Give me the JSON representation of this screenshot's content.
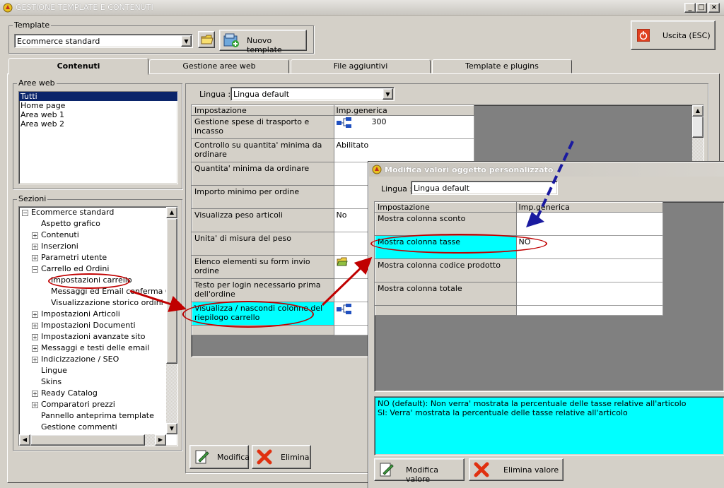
{
  "window": {
    "title": "GESTIONE TEMPLATE E CONTENUTI",
    "min": "_",
    "max": "□",
    "close": "×"
  },
  "template": {
    "group_label": "Template",
    "selected": "Ecommerce standard",
    "new_button": "Nuovo template"
  },
  "exit_button": "Uscita (ESC)",
  "tabs": [
    {
      "label": "Contenuti",
      "active": true
    },
    {
      "label": "Gestione aree web"
    },
    {
      "label": "File aggiuntivi"
    },
    {
      "label": "Template e plugins"
    }
  ],
  "aree_web": {
    "label": "Aree web",
    "items": [
      "Tutti",
      "Home page",
      "Area web 1",
      "Area web 2"
    ],
    "selected_index": 0
  },
  "sezioni": {
    "label": "Sezioni",
    "tree": [
      {
        "label": "Ecommerce standard",
        "level": 0,
        "expander": "−"
      },
      {
        "label": "Aspetto grafico",
        "level": 1,
        "expander": ""
      },
      {
        "label": "Contenuti",
        "level": 1,
        "expander": "+"
      },
      {
        "label": "Inserzioni",
        "level": 1,
        "expander": "+"
      },
      {
        "label": "Parametri utente",
        "level": 1,
        "expander": "+"
      },
      {
        "label": "Carrello ed Ordini",
        "level": 1,
        "expander": "−"
      },
      {
        "label": "Impostazioni carrello",
        "level": 2,
        "expander": ""
      },
      {
        "label": "Messaggi ed Email conferma Ordini",
        "level": 2,
        "expander": ""
      },
      {
        "label": "Visualizzazione storico ordini",
        "level": 2,
        "expander": ""
      },
      {
        "label": "Impostazioni Articoli",
        "level": 1,
        "expander": "+"
      },
      {
        "label": "Impostazioni Documenti",
        "level": 1,
        "expander": "+"
      },
      {
        "label": "Impostazioni avanzate sito",
        "level": 1,
        "expander": "+"
      },
      {
        "label": "Messaggi e testi delle email",
        "level": 1,
        "expander": "+"
      },
      {
        "label": "Indicizzazione / SEO",
        "level": 1,
        "expander": "+"
      },
      {
        "label": "Lingue",
        "level": 1,
        "expander": ""
      },
      {
        "label": "Skins",
        "level": 1,
        "expander": ""
      },
      {
        "label": "Ready Catalog",
        "level": 1,
        "expander": "+"
      },
      {
        "label": "Comparatori prezzi",
        "level": 1,
        "expander": "+"
      },
      {
        "label": "Pannello anteprima template",
        "level": 1,
        "expander": ""
      },
      {
        "label": "Gestione commenti",
        "level": 1,
        "expander": ""
      }
    ]
  },
  "main": {
    "lingua_label": "Lingua :",
    "lingua_value": "Lingua default",
    "col_impostazione": "Impostazione",
    "col_generica": "Imp.generica",
    "rows": [
      {
        "key": "Gestione spese di trasporto e incasso",
        "value": "300",
        "icon": "tree-icon"
      },
      {
        "key": "Controllo su quantita' minima da ordinare",
        "value": "Abilitato"
      },
      {
        "key": "Quantita' minima da ordinare",
        "value": ""
      },
      {
        "key": "Importo minimo per ordine",
        "value": ""
      },
      {
        "key": "Visualizza peso articoli",
        "value": "No"
      },
      {
        "key": "Unita' di misura del peso",
        "value": ""
      },
      {
        "key": "Elenco elementi su form invio ordine",
        "value": "",
        "icon": "folder-icon"
      },
      {
        "key": "Testo per login necessario prima dell'ordine",
        "value": ""
      },
      {
        "key": "Visualizza / nascondi colonne del riepilogo carrello",
        "value": "",
        "icon": "tree-icon",
        "highlight": true
      }
    ],
    "modifica": "Modifica",
    "elimina": "Elimina"
  },
  "dialog": {
    "title": "Modifica valori oggetto personalizzato",
    "lingua_label": "Lingua :",
    "lingua_value": "Lingua default",
    "col_impostazione": "Impostazione",
    "col_generica": "Imp.generica",
    "rows": [
      {
        "key": "Mostra colonna sconto",
        "value": ""
      },
      {
        "key": "Mostra colonna tasse",
        "value": "NO",
        "highlight": true
      },
      {
        "key": "Mostra colonna codice prodotto",
        "value": ""
      },
      {
        "key": "Mostra colonna totale",
        "value": ""
      }
    ],
    "description": [
      "NO (default): Non verra' mostrata la percentuale delle tasse relative all'articolo",
      "SI: Verra' mostrata la percentuale delle tasse relative all'articolo"
    ],
    "modifica_valore": "Modifica valore",
    "elimina_valore": "Elimina valore"
  },
  "colors": {
    "highlight": "#00ffff",
    "selection": "#0a246a",
    "annotation": "#c00000",
    "arrow_blue": "#1a1aa0"
  }
}
